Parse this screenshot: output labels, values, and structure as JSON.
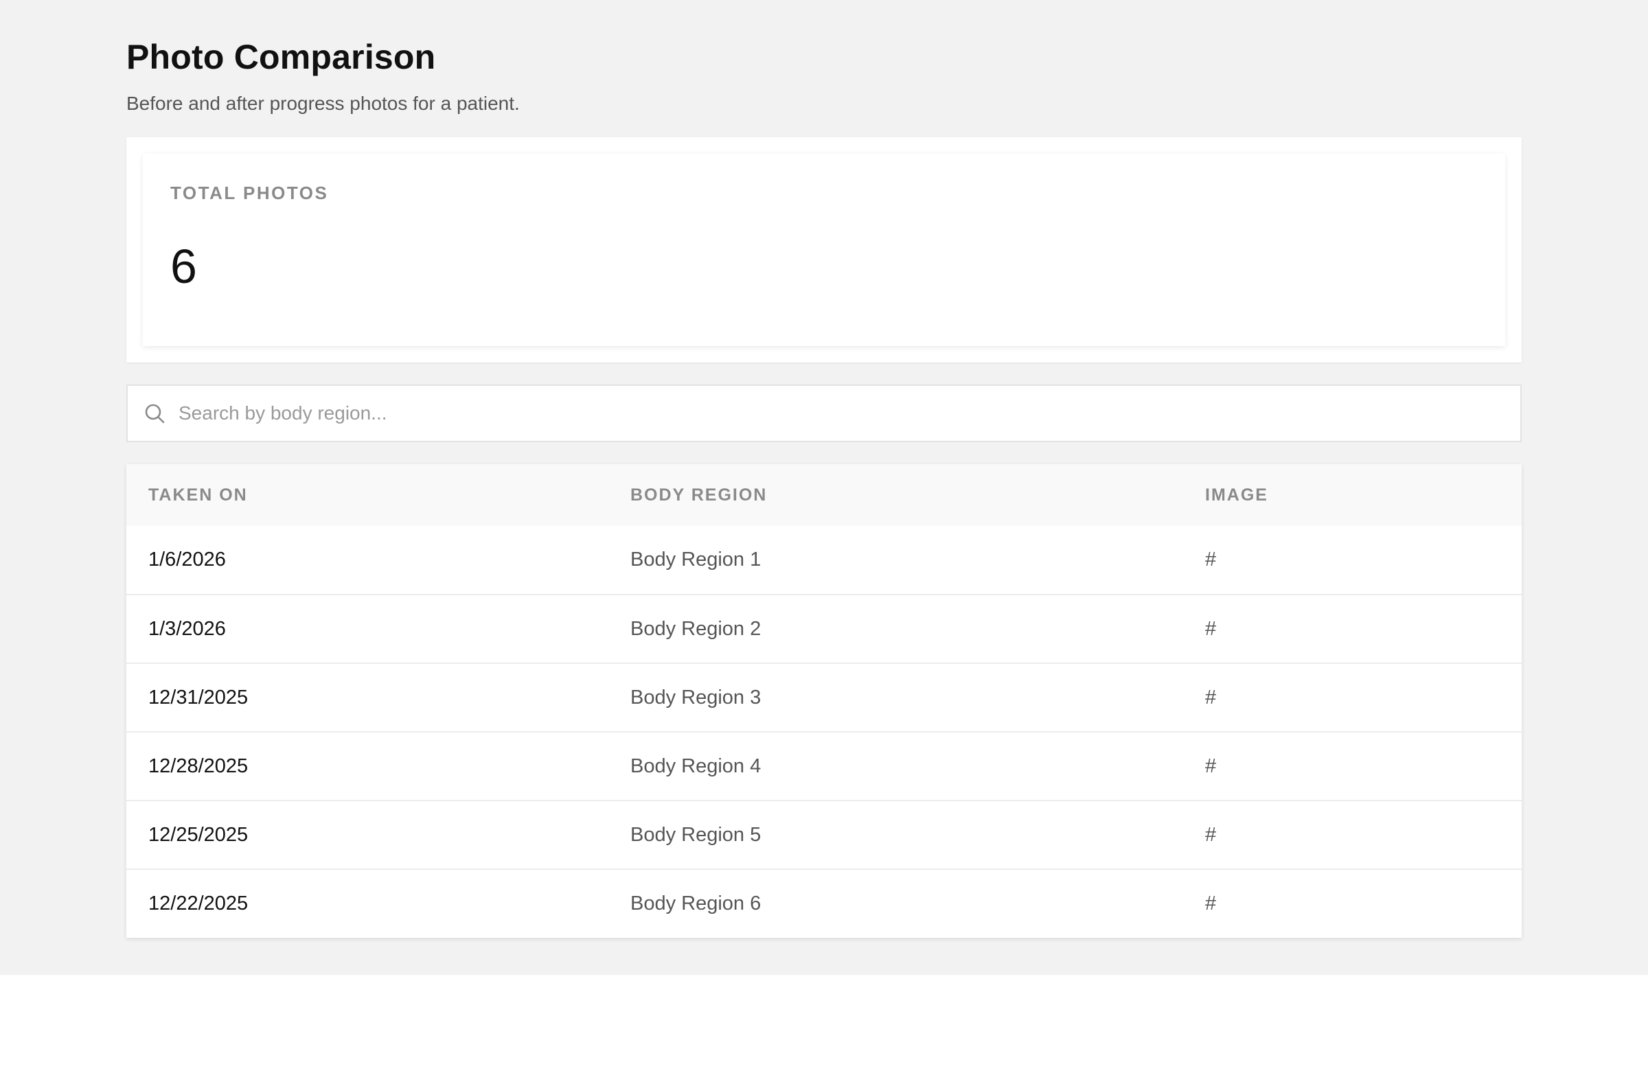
{
  "page": {
    "title": "Photo Comparison",
    "subtitle": "Before and after progress photos for a patient."
  },
  "stats": {
    "total_photos_label": "TOTAL PHOTOS",
    "total_photos_value": "6"
  },
  "search": {
    "icon": "search-icon",
    "placeholder": "Search by body region...",
    "value": ""
  },
  "table": {
    "columns": [
      "TAKEN ON",
      "BODY REGION",
      "IMAGE"
    ],
    "rows": [
      {
        "taken_on": "1/6/2026",
        "body_region": "Body Region 1",
        "image": "#"
      },
      {
        "taken_on": "1/3/2026",
        "body_region": "Body Region 2",
        "image": "#"
      },
      {
        "taken_on": "12/31/2025",
        "body_region": "Body Region 3",
        "image": "#"
      },
      {
        "taken_on": "12/28/2025",
        "body_region": "Body Region 4",
        "image": "#"
      },
      {
        "taken_on": "12/25/2025",
        "body_region": "Body Region 5",
        "image": "#"
      },
      {
        "taken_on": "12/22/2025",
        "body_region": "Body Region 6",
        "image": "#"
      }
    ]
  },
  "colors": {
    "page_background": "#f2f2f2",
    "card_background": "#ffffff",
    "muted_text": "#8a8a8a",
    "primary_text": "#111111"
  }
}
